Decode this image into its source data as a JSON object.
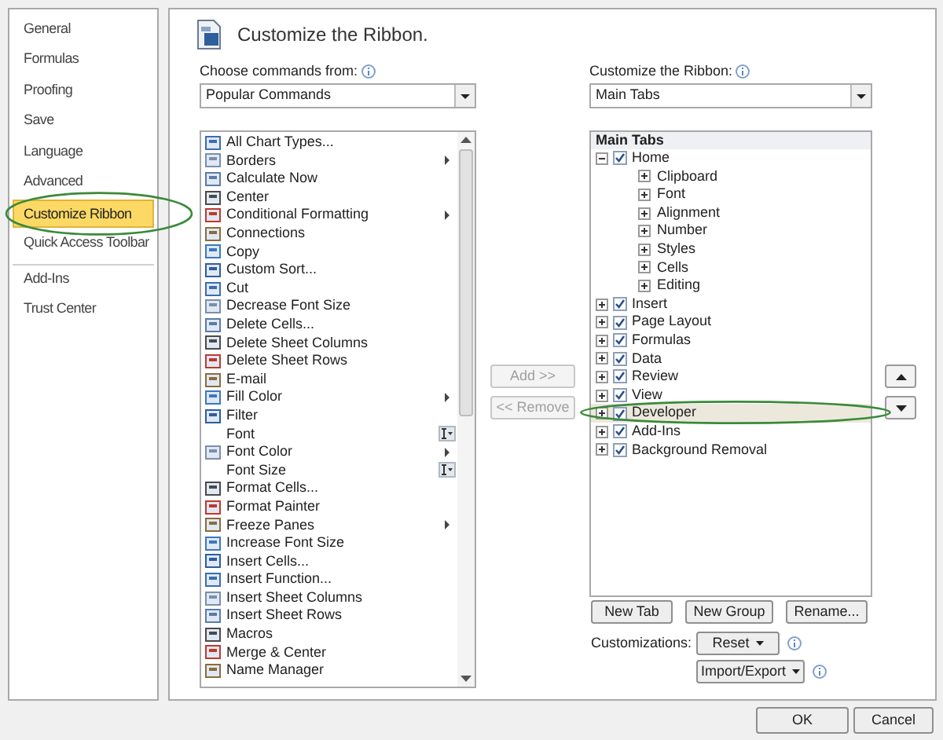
{
  "sidebar": {
    "items": [
      {
        "label": "General",
        "selected": false,
        "separator_before": false
      },
      {
        "label": "Formulas",
        "selected": false,
        "separator_before": false
      },
      {
        "label": "Proofing",
        "selected": false,
        "separator_before": false
      },
      {
        "label": "Save",
        "selected": false,
        "separator_before": false
      },
      {
        "label": "Language",
        "selected": false,
        "separator_before": false
      },
      {
        "label": "Advanced",
        "selected": false,
        "separator_before": false
      },
      {
        "label": "Customize Ribbon",
        "selected": true,
        "separator_before": false
      },
      {
        "label": "Quick Access Toolbar",
        "selected": false,
        "separator_before": false
      },
      {
        "label": "Add-Ins",
        "selected": false,
        "separator_before": true
      },
      {
        "label": "Trust Center",
        "selected": false,
        "separator_before": false
      }
    ]
  },
  "header": {
    "title": "Customize the Ribbon."
  },
  "commands": {
    "label": "Choose commands from:",
    "dropdown": "Popular Commands",
    "items": [
      {
        "label": "All Chart Types...",
        "icon": true,
        "kind": "plain"
      },
      {
        "label": "Borders",
        "icon": true,
        "kind": "submenu"
      },
      {
        "label": "Calculate Now",
        "icon": true,
        "kind": "plain"
      },
      {
        "label": "Center",
        "icon": true,
        "kind": "plain"
      },
      {
        "label": "Conditional Formatting",
        "icon": true,
        "kind": "submenu"
      },
      {
        "label": "Connections",
        "icon": true,
        "kind": "plain"
      },
      {
        "label": "Copy",
        "icon": true,
        "kind": "plain"
      },
      {
        "label": "Custom Sort...",
        "icon": true,
        "kind": "plain"
      },
      {
        "label": "Cut",
        "icon": true,
        "kind": "plain"
      },
      {
        "label": "Decrease Font Size",
        "icon": true,
        "kind": "plain"
      },
      {
        "label": "Delete Cells...",
        "icon": true,
        "kind": "plain"
      },
      {
        "label": "Delete Sheet Columns",
        "icon": true,
        "kind": "plain"
      },
      {
        "label": "Delete Sheet Rows",
        "icon": true,
        "kind": "plain"
      },
      {
        "label": "E-mail",
        "icon": true,
        "kind": "plain"
      },
      {
        "label": "Fill Color",
        "icon": true,
        "kind": "submenu"
      },
      {
        "label": "Filter",
        "icon": true,
        "kind": "plain"
      },
      {
        "label": "Font",
        "icon": false,
        "kind": "field"
      },
      {
        "label": "Font Color",
        "icon": true,
        "kind": "submenu"
      },
      {
        "label": "Font Size",
        "icon": false,
        "kind": "field"
      },
      {
        "label": "Format Cells...",
        "icon": true,
        "kind": "plain"
      },
      {
        "label": "Format Painter",
        "icon": true,
        "kind": "plain"
      },
      {
        "label": "Freeze Panes",
        "icon": true,
        "kind": "submenu"
      },
      {
        "label": "Increase Font Size",
        "icon": true,
        "kind": "plain"
      },
      {
        "label": "Insert Cells...",
        "icon": true,
        "kind": "plain"
      },
      {
        "label": "Insert Function...",
        "icon": true,
        "kind": "plain"
      },
      {
        "label": "Insert Sheet Columns",
        "icon": true,
        "kind": "plain"
      },
      {
        "label": "Insert Sheet Rows",
        "icon": true,
        "kind": "plain"
      },
      {
        "label": "Macros",
        "icon": true,
        "kind": "plain"
      },
      {
        "label": "Merge & Center",
        "icon": true,
        "kind": "plain"
      },
      {
        "label": "Name Manager",
        "icon": true,
        "kind": "plain"
      }
    ]
  },
  "middle_buttons": [
    {
      "label": "Add >>",
      "disabled": true
    },
    {
      "label": "<< Remove",
      "disabled": true
    }
  ],
  "ribbon": {
    "label": "Customize the Ribbon:",
    "dropdown": "Main Tabs",
    "tree_header": "Main Tabs",
    "tree": [
      {
        "label": "Home",
        "checked": true,
        "expanded": true,
        "selected": false,
        "children": [
          {
            "label": "Clipboard",
            "expanded": false
          },
          {
            "label": "Font",
            "expanded": false
          },
          {
            "label": "Alignment",
            "expanded": false
          },
          {
            "label": "Number",
            "expanded": false
          },
          {
            "label": "Styles",
            "expanded": false
          },
          {
            "label": "Cells",
            "expanded": false
          },
          {
            "label": "Editing",
            "expanded": false
          }
        ]
      },
      {
        "label": "Insert",
        "checked": true,
        "expanded": false,
        "selected": false
      },
      {
        "label": "Page Layout",
        "checked": true,
        "expanded": false,
        "selected": false
      },
      {
        "label": "Formulas",
        "checked": true,
        "expanded": false,
        "selected": false
      },
      {
        "label": "Data",
        "checked": true,
        "expanded": false,
        "selected": false
      },
      {
        "label": "Review",
        "checked": true,
        "expanded": false,
        "selected": false
      },
      {
        "label": "View",
        "checked": true,
        "expanded": false,
        "selected": false
      },
      {
        "label": "Developer",
        "checked": true,
        "expanded": false,
        "selected": true
      },
      {
        "label": "Add-Ins",
        "checked": true,
        "expanded": false,
        "selected": false
      },
      {
        "label": "Background Removal",
        "checked": true,
        "expanded": false,
        "selected": false
      }
    ],
    "tree_buttons": [
      "New Tab",
      "New Group",
      "Rename..."
    ],
    "customizations_label": "Customizations:",
    "reset": "Reset",
    "import_export": "Import/Export"
  },
  "footer": {
    "buttons": [
      "OK",
      "Cancel"
    ]
  }
}
